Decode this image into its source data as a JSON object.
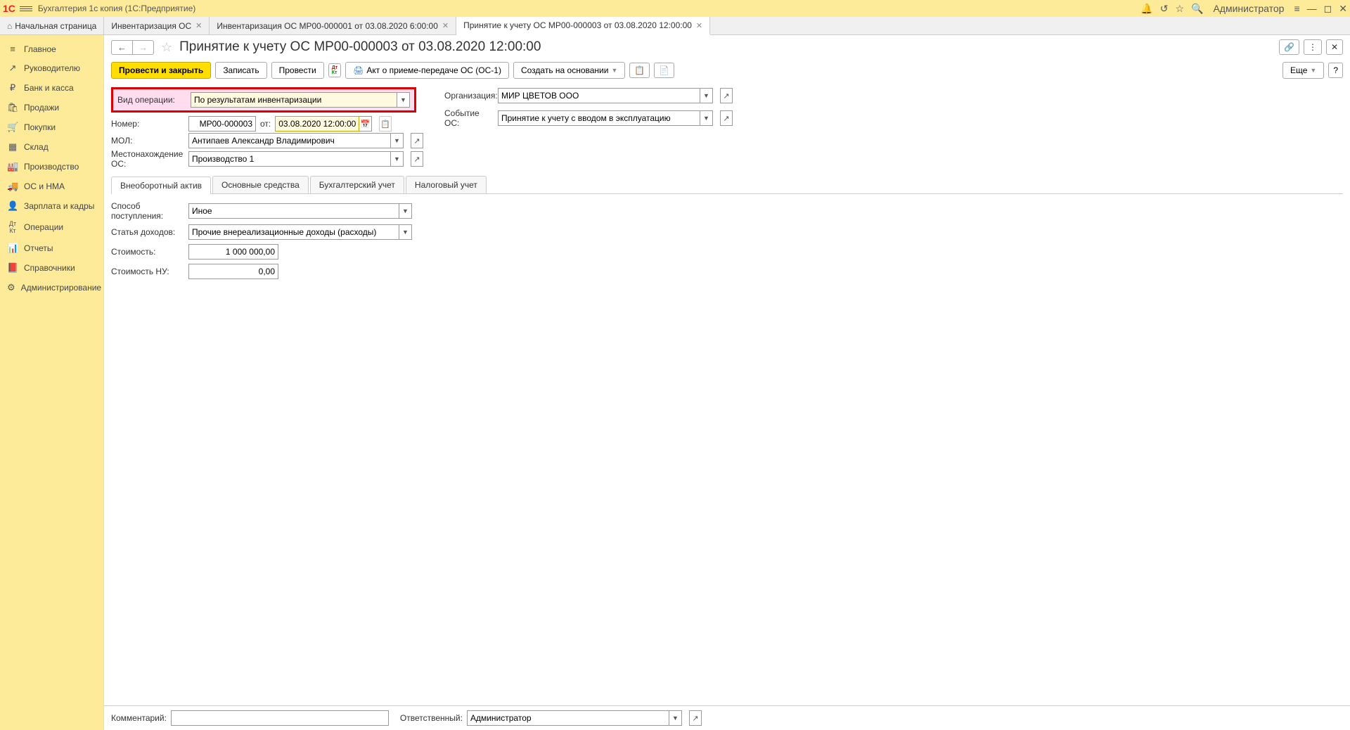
{
  "titlebar": {
    "app_title": "Бухгалтерия 1с копия  (1С:Предприятие)",
    "user": "Администратор"
  },
  "tabs": {
    "home": "Начальная страница",
    "tab1": "Инвентаризация ОС",
    "tab2": "Инвентаризация ОС МР00-000001 от 03.08.2020 6:00:00",
    "tab3": "Принятие к учету ОС МР00-000003 от 03.08.2020 12:00:00"
  },
  "sidebar": [
    {
      "icon": "≡",
      "label": "Главное"
    },
    {
      "icon": "↗",
      "label": "Руководителю"
    },
    {
      "icon": "₽",
      "label": "Банк и касса"
    },
    {
      "icon": "🛍",
      "label": "Продажи"
    },
    {
      "icon": "🛒",
      "label": "Покупки"
    },
    {
      "icon": "▦",
      "label": "Склад"
    },
    {
      "icon": "🏭",
      "label": "Производство"
    },
    {
      "icon": "🚚",
      "label": "ОС и НМА"
    },
    {
      "icon": "👤",
      "label": "Зарплата и кадры"
    },
    {
      "icon": "ᴰᴷ",
      "label": "Операции"
    },
    {
      "icon": "📊",
      "label": "Отчеты"
    },
    {
      "icon": "📕",
      "label": "Справочники"
    },
    {
      "icon": "⚙",
      "label": "Администрирование"
    }
  ],
  "page": {
    "title": "Принятие к учету ОС МР00-000003 от 03.08.2020 12:00:00"
  },
  "actions": {
    "post_close": "Провести и закрыть",
    "save": "Записать",
    "post": "Провести",
    "print": "Акт о приеме-передаче ОС (ОС-1)",
    "create_based": "Создать на основании",
    "more": "Еще"
  },
  "form": {
    "op_type_label": "Вид операции:",
    "op_type": "По результатам инвентаризации",
    "org_label": "Организация:",
    "org": "МИР ЦВЕТОВ ООО",
    "number_label": "Номер:",
    "number": "МР00-000003",
    "from_label": "от:",
    "date": "03.08.2020 12:00:00",
    "event_label": "Событие ОС:",
    "event": "Принятие к учету с вводом в эксплуатацию",
    "mol_label": "МОЛ:",
    "mol": "Антипаев Александр Владимирович",
    "loc_label": "Местонахождение ОС:",
    "loc": "Производство 1",
    "inner_tabs": {
      "t1": "Внеоборотный актив",
      "t2": "Основные средства",
      "t3": "Бухгалтерский учет",
      "t4": "Налоговый учет"
    },
    "receipt_method_label": "Способ поступления:",
    "receipt_method": "Иное",
    "income_item_label": "Статья доходов:",
    "income_item": "Прочие внереализационные доходы (расходы)",
    "cost_label": "Стоимость:",
    "cost": "1 000 000,00",
    "cost_nu_label": "Стоимость НУ:",
    "cost_nu": "0,00"
  },
  "footer": {
    "comment_label": "Комментарий:",
    "comment": "",
    "responsible_label": "Ответственный:",
    "responsible": "Администратор"
  }
}
